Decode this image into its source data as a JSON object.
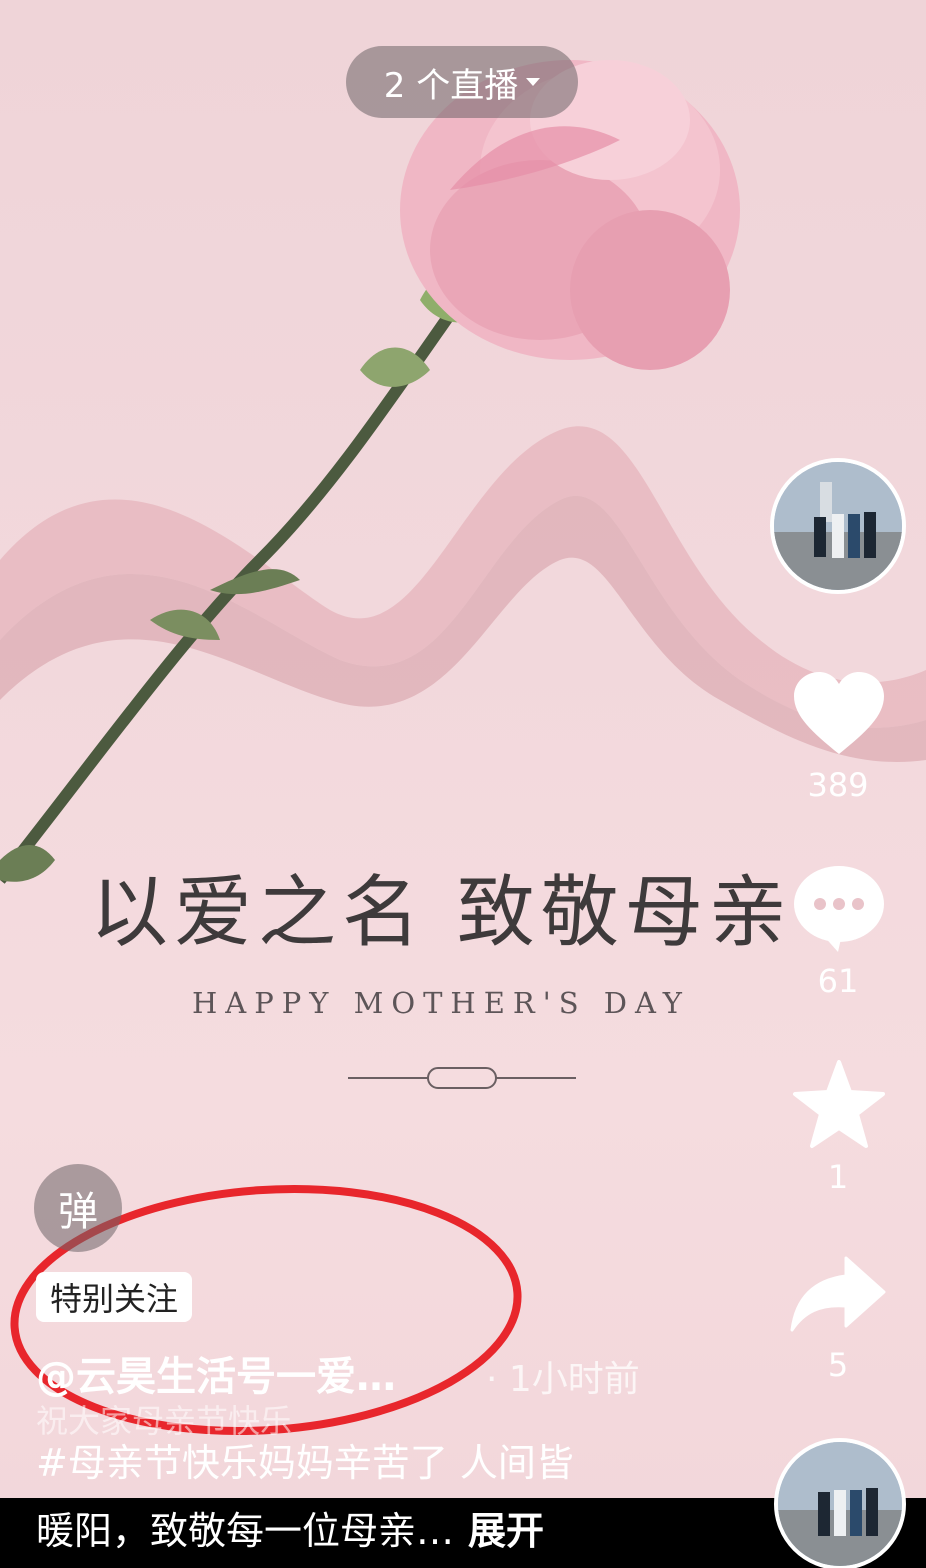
{
  "live": {
    "label": "2 个直播"
  },
  "poster": {
    "title": "以爱之名  致敬母亲",
    "subtitle": "HAPPY MOTHER'S DAY"
  },
  "rail": {
    "likes": "389",
    "comments": "61",
    "favorites": "1",
    "shares": "5"
  },
  "danmu": {
    "label": "弹"
  },
  "tag": {
    "label": "特别关注"
  },
  "author": {
    "name": "@云昊生活号一爱…",
    "time": "· 1小时前"
  },
  "caption": {
    "line0": "祝大家母亲节快乐",
    "line1": "#母亲节快乐妈妈辛苦了 人间皆",
    "line2": "暖阳，致敬每一位母亲…",
    "expand": "展开"
  },
  "colors": {
    "background": "#f2d8dc",
    "annotation_circle": "#e8262c"
  }
}
